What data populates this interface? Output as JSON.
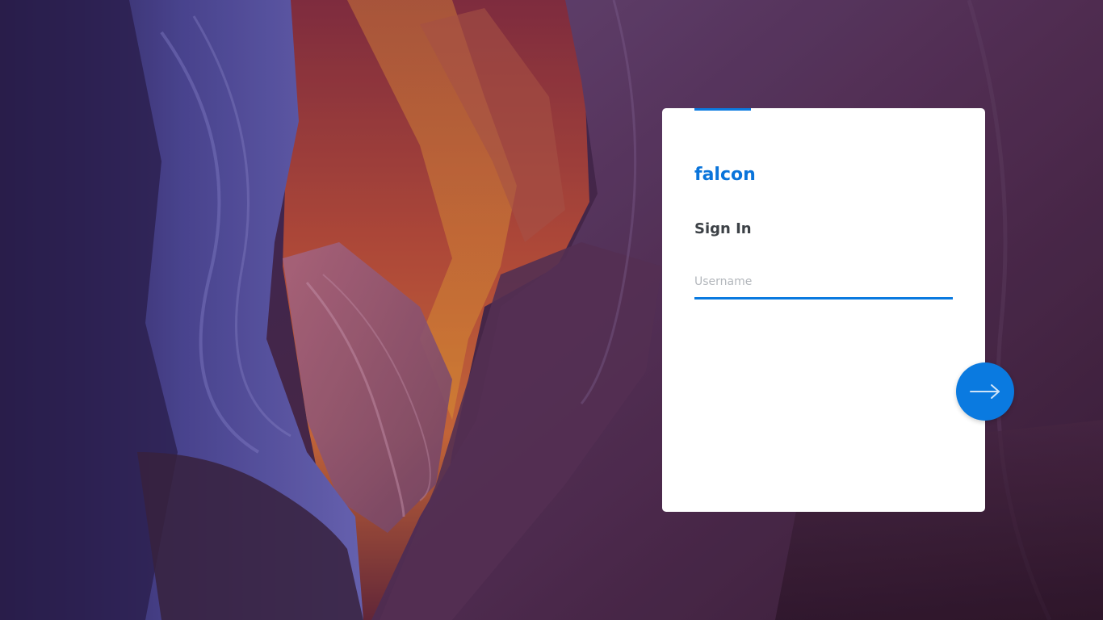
{
  "login": {
    "brand": "falcon",
    "heading": "Sign In",
    "username": {
      "placeholder": "Username",
      "value": ""
    },
    "next_icon": "arrow-right-icon"
  },
  "colors": {
    "accent": "#0a7ae0",
    "brand": "#0a74da",
    "heading": "#3c4146",
    "placeholder": "#b3b7bc",
    "card": "#ffffff"
  },
  "background": {
    "description_icon": "canyon-wallpaper"
  }
}
